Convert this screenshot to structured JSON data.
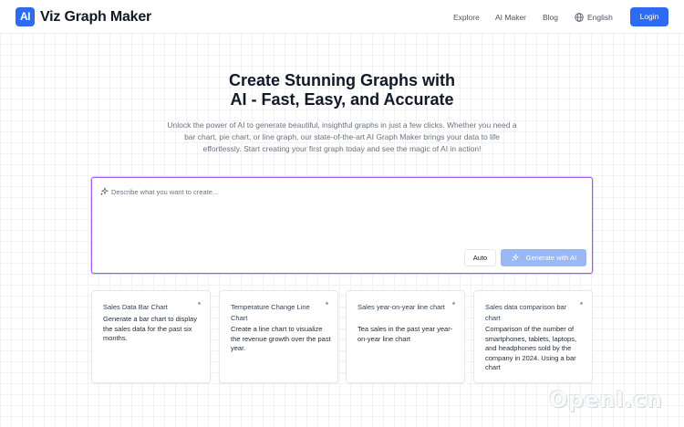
{
  "app": {
    "logo_badge": "AI",
    "name": "Viz Graph Maker",
    "brand_color": "#2f6bf0"
  },
  "nav": {
    "explore": "Explore",
    "ai_maker": "AI Maker",
    "blog": "Blog",
    "language": "English",
    "login": "Login"
  },
  "hero": {
    "title_line1": "Create Stunning Graphs with",
    "title_line2": "AI - Fast, Easy, and Accurate",
    "description": "Unlock the power of AI to generate beautiful, insightful graphs in just a few clicks. Whether you need a bar chart, pie chart, or line graph, our state-of-the-art AI Graph Maker brings your data to life effortlessly. Start creating your first graph today and see the magic of AI in action!"
  },
  "prompt": {
    "placeholder": "Describe what you want to create...",
    "auto_label": "Auto",
    "generate_label": "Generate with AI",
    "border_color": "#a855f7"
  },
  "examples": [
    {
      "title": "Sales Data Bar Chart",
      "description": "Generate a bar chart to display the sales data for the past six months."
    },
    {
      "title": "Temperature Change Line Chart",
      "description": "Create a line chart to visualize the revenue growth over the past year."
    },
    {
      "title": "Sales year-on-year line chart",
      "description": "Tea sales in the past year year-on-year line chart"
    },
    {
      "title": "Sales data comparison bar chart",
      "description": "Comparison of the number of smartphones, tablets, laptops, and headphones sold by the company in 2024. Using a bar chart"
    }
  ],
  "watermark": "OpenI.cn"
}
